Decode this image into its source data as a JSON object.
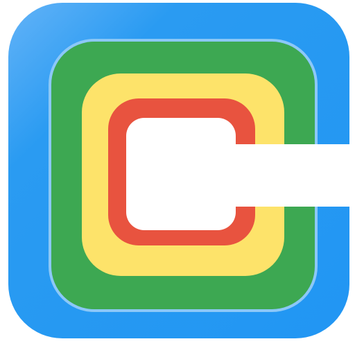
{
  "icon": {
    "semantic": "nested-rings-c-logo-icon",
    "colors": {
      "blue": "#2196F3",
      "blue_highlight": "#64B5F6",
      "green": "#3DA852",
      "yellow": "#FDE36A",
      "red": "#E8533F",
      "inner": "#FFFFFF",
      "background": "#FFFFFF"
    }
  }
}
